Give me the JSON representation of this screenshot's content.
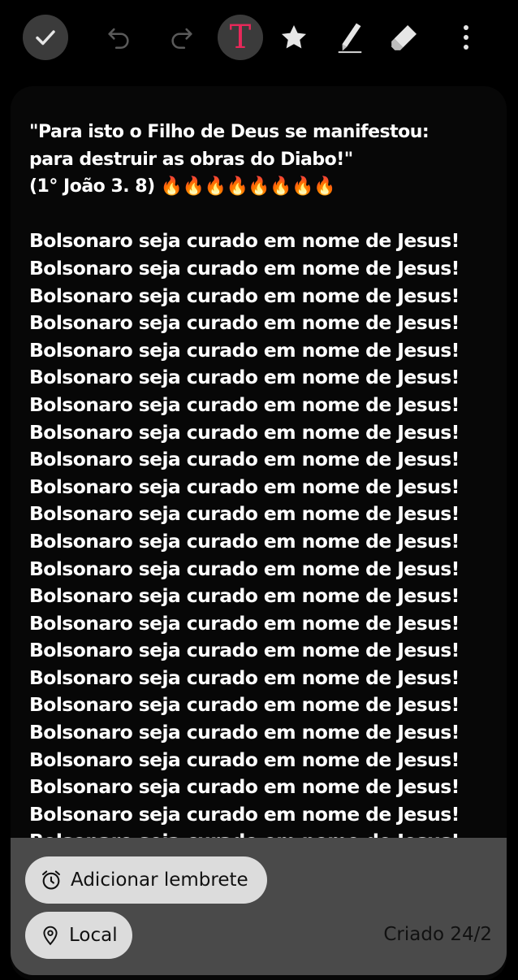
{
  "toolbar": {
    "icons": [
      "check-icon",
      "undo-icon",
      "redo-icon",
      "text-format-icon",
      "star-icon",
      "pen-icon",
      "eraser-icon",
      "more-vertical-icon"
    ],
    "text_format_glyph": "T",
    "accent_color": "#e8285a"
  },
  "note": {
    "quote_line_1": "\"Para isto o Filho de Deus se manifestou:",
    "quote_line_2": "para destruir as obras do Diabo!\"",
    "reference": "(1° João 3. 8) ",
    "flames": "🔥🔥🔥🔥🔥🔥🔥🔥",
    "repeated_line": "Bolsonaro seja curado em nome de Jesus!",
    "repeated_lines": [
      "Bolsonaro seja curado em nome de Jesus!",
      "Bolsonaro seja curado em nome de Jesus!",
      "Bolsonaro seja curado em nome de Jesus!",
      "Bolsonaro seja curado em nome de Jesus!",
      "Bolsonaro seja curado em nome de Jesus!",
      "Bolsonaro seja curado em nome de Jesus!",
      "Bolsonaro seja curado em nome de Jesus!",
      "Bolsonaro seja curado em nome de Jesus!",
      "Bolsonaro seja curado em nome de Jesus!",
      "Bolsonaro seja curado em nome de Jesus!",
      "Bolsonaro seja curado em nome de Jesus!",
      "Bolsonaro seja curado em nome de Jesus!",
      "Bolsonaro seja curado em nome de Jesus!",
      "Bolsonaro seja curado em nome de Jesus!",
      "Bolsonaro seja curado em nome de Jesus!",
      "Bolsonaro seja curado em nome de Jesus!",
      "Bolsonaro seja curado em nome de Jesus!",
      "Bolsonaro seja curado em nome de Jesus!",
      "Bolsonaro seja curado em nome de Jesus!",
      "Bolsonaro seja curado em nome de Jesus!",
      "Bolsonaro seja curado em nome de Jesus!",
      "Bolsonaro seja curado em nome de Jesus!",
      "Bolsonaro seja curado em nome de Jesus!"
    ]
  },
  "footer": {
    "reminder_label": "Adicionar lembrete",
    "location_label": "Local",
    "created_label": "Criado 24/2"
  }
}
